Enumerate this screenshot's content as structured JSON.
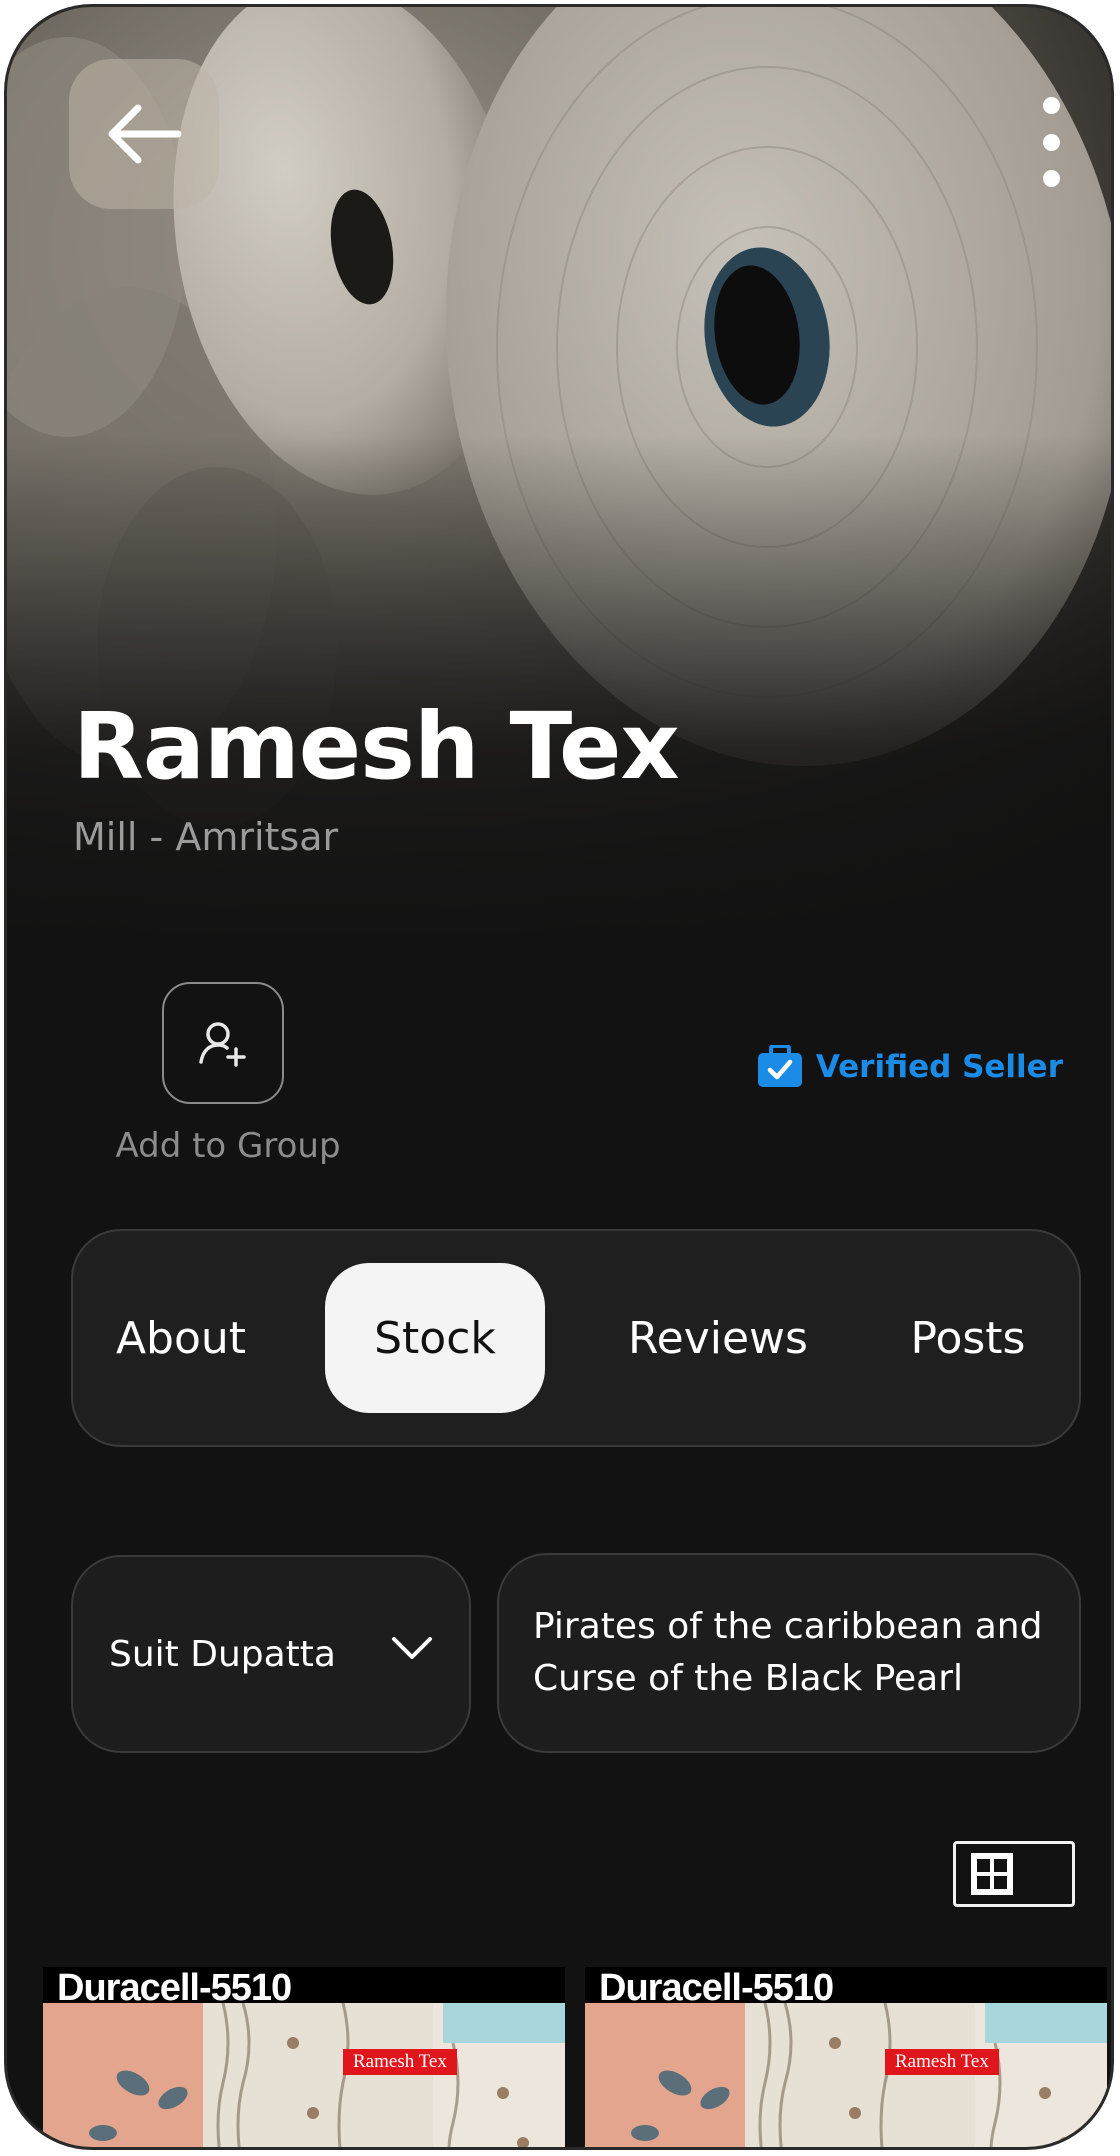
{
  "header": {
    "title": "Ramesh Tex",
    "subtitle": "Mill - Amritsar",
    "back_icon": "arrow-left-icon",
    "more_icon": "more-vertical-icon"
  },
  "actions": {
    "add_group_label": "Add to Group",
    "add_group_icon": "user-add-icon",
    "verified_label": "Verified Seller",
    "verified_icon": "verified-badge-icon",
    "verified_color": "#1a8ce8"
  },
  "tabs": [
    {
      "label": "About",
      "active": false
    },
    {
      "label": "Stock",
      "active": true
    },
    {
      "label": "Reviews",
      "active": false
    },
    {
      "label": "Posts",
      "active": false
    }
  ],
  "filters": {
    "category_value": "Suit Dupatta",
    "category_icon": "chevron-down-icon",
    "search_value": "Pirates of the caribbean and Curse of the Black Pearl"
  },
  "view_toggle": {
    "icon": "grid-icon"
  },
  "products": [
    {
      "code": "Duracell-5510",
      "brand": "Ramesh Tex"
    },
    {
      "code": "Duracell-5510",
      "brand": "Ramesh Tex"
    }
  ]
}
